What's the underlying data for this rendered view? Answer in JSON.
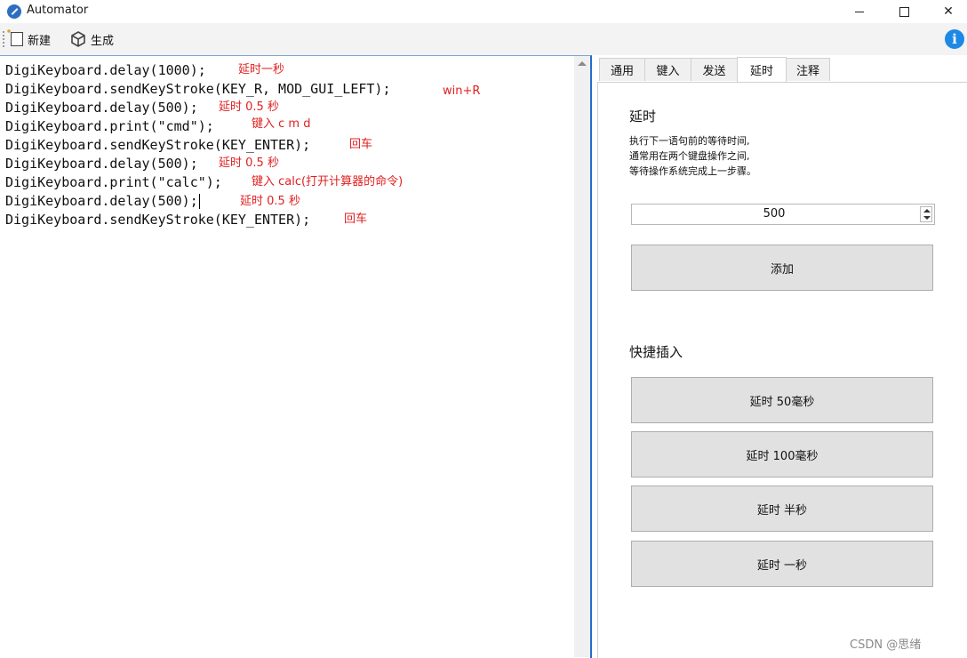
{
  "window": {
    "title": "Automator"
  },
  "toolbar": {
    "new_label": "新建",
    "generate_label": "生成",
    "info_glyph": "i"
  },
  "editor": {
    "lines": [
      {
        "code": "DigiKeyboard.delay(1000);",
        "note": "延时一秒"
      },
      {
        "code": "DigiKeyboard.sendKeyStroke(KEY_R, MOD_GUI_LEFT);",
        "note": "win+R"
      },
      {
        "code": "DigiKeyboard.delay(500);",
        "note": "延时 0.5 秒"
      },
      {
        "code": "DigiKeyboard.print(\"cmd\");",
        "note": "键入 c m d"
      },
      {
        "code": "DigiKeyboard.sendKeyStroke(KEY_ENTER);",
        "note": "回车"
      },
      {
        "code": "DigiKeyboard.delay(500);",
        "note": "延时 0.5 秒"
      },
      {
        "code": "DigiKeyboard.print(\"calc\");",
        "note": "键入 calc(打开计算器的命令)"
      },
      {
        "code": "DigiKeyboard.delay(500);",
        "note": "延时 0.5 秒"
      },
      {
        "code": "DigiKeyboard.sendKeyStroke(KEY_ENTER);",
        "note": "回车"
      }
    ]
  },
  "tabs": [
    {
      "label": "通用",
      "active": false
    },
    {
      "label": "键入",
      "active": false
    },
    {
      "label": "发送",
      "active": false
    },
    {
      "label": "延时",
      "active": true
    },
    {
      "label": "注释",
      "active": false
    }
  ],
  "delay_panel": {
    "title": "延时",
    "description_lines": [
      "执行下一语句前的等待时间,",
      "通常用在两个键盘操作之间,",
      "等待操作系统完成上一步骤。"
    ],
    "value": "500",
    "add_label": "添加",
    "quick_title": "快捷插入",
    "quick_buttons": [
      "延时 50毫秒",
      "延时 100毫秒",
      "延时 半秒",
      "延时 一秒"
    ]
  },
  "watermark": "CSDN @思绪"
}
